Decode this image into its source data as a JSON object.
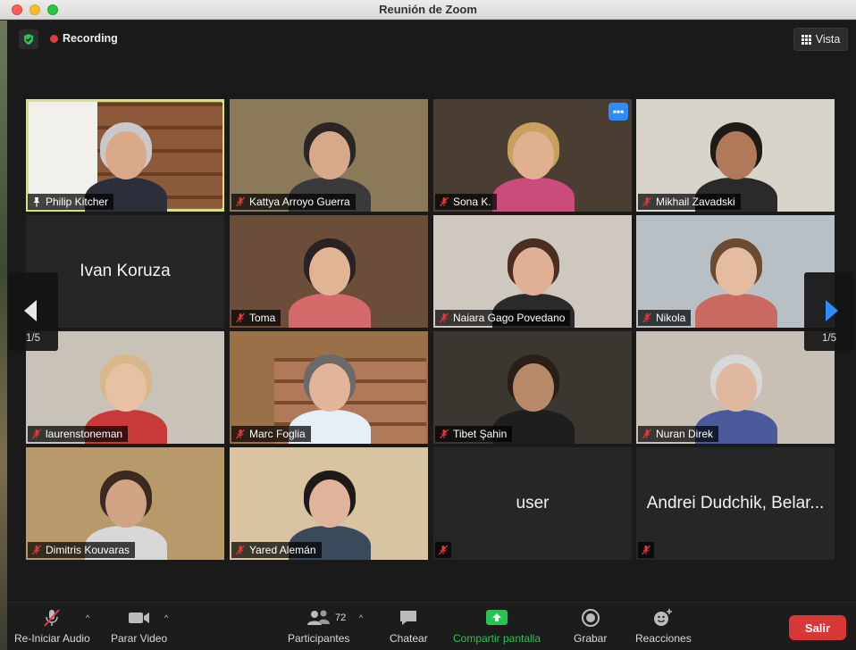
{
  "window": {
    "title": "Reunión de Zoom"
  },
  "top": {
    "recording_label": "Recording",
    "view_label": "Vista"
  },
  "pagination": {
    "left": "1/5",
    "right": "1/5"
  },
  "participants": [
    {
      "name": "Philip Kitcher",
      "bg": "#8a6a4a"
    },
    {
      "name": "Kattya Arroyo Guerra",
      "bg": "#8a7a5a"
    },
    {
      "name": "Sona K.",
      "bg": "#4a3e32"
    },
    {
      "name": "Mikhail Zavadski",
      "bg": "#d8d4cc"
    },
    {
      "name": "Ivan Koruza"
    },
    {
      "name": "Toma",
      "bg": "#6a4e3a"
    },
    {
      "name": "Naiara Gago Povedano",
      "bg": "#cfc8c0"
    },
    {
      "name": "Nikola",
      "bg": "#b8c0c6"
    },
    {
      "name": "laurenstoneman",
      "bg": "#c8c2b8"
    },
    {
      "name": "Marc Foglia",
      "bg": "#9a7048"
    },
    {
      "name": "Tibet Şahin",
      "bg": "#3a3630"
    },
    {
      "name": "Nuran Direk",
      "bg": "#c8c0b4"
    },
    {
      "name": "Dimitris Kouvaras",
      "bg": "#b89a6a"
    },
    {
      "name": "Yared Alemán",
      "bg": "#d8c4a0"
    },
    {
      "name": "user"
    },
    {
      "name": "Andrei Dudchik, Belar..."
    }
  ],
  "toolbar": {
    "audio_label": "Re-Iniciar Audio",
    "video_label": "Parar Video",
    "participants_label": "Participantes",
    "participants_count": "72",
    "chat_label": "Chatear",
    "share_label": "Compartir pantalla",
    "record_label": "Grabar",
    "reactions_label": "Reacciones",
    "leave_label": "Salir"
  },
  "colors": {
    "accent": "#2d8cff",
    "share_green": "#23c552",
    "leave_red": "#d93636",
    "active_speaker": "#d6e07c"
  }
}
